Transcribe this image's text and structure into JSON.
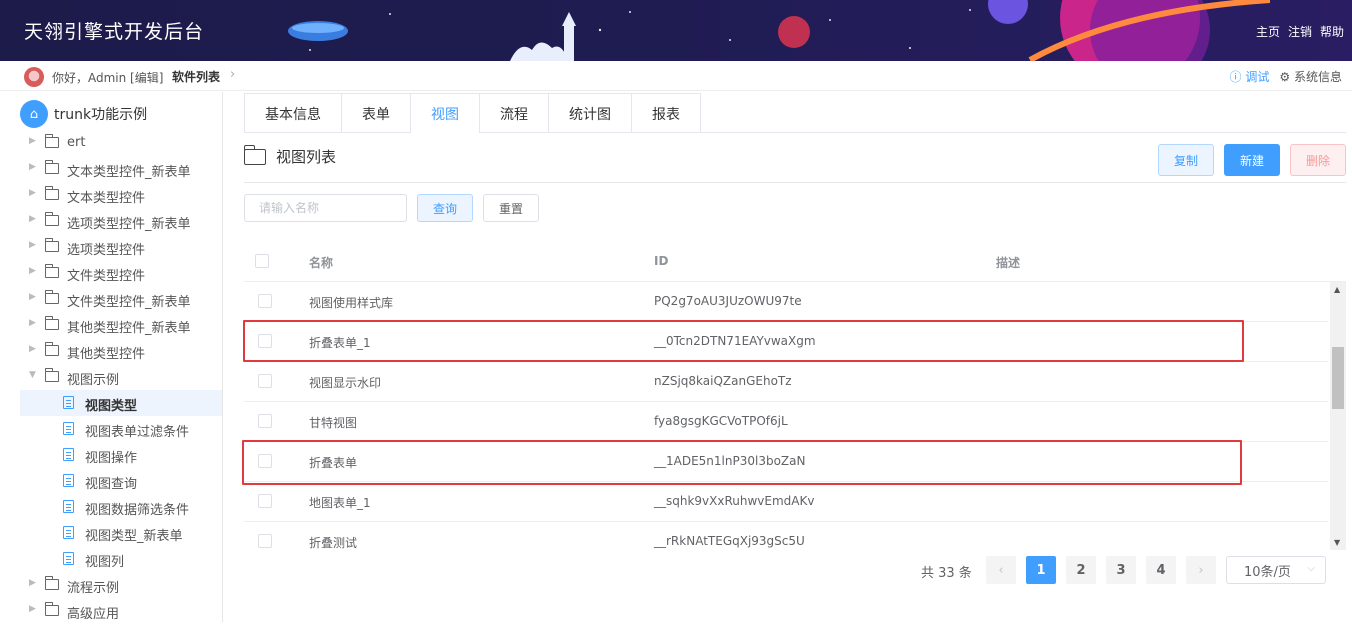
{
  "header": {
    "title": "天翎引擎式开发后台",
    "links": [
      "主页",
      "注销",
      "帮助"
    ]
  },
  "breadcrumb": {
    "greeting": "你好，Admin [编辑]",
    "current": "软件列表",
    "debug": "调试",
    "system_info": "系统信息"
  },
  "sidebar": {
    "root": "trunk功能示例",
    "items": [
      {
        "label": "ert",
        "type": "folder",
        "expanded": false
      },
      {
        "label": "文本类型控件_新表单",
        "type": "folder",
        "expanded": false
      },
      {
        "label": "文本类型控件",
        "type": "folder",
        "expanded": false
      },
      {
        "label": "选项类型控件_新表单",
        "type": "folder",
        "expanded": false
      },
      {
        "label": "选项类型控件",
        "type": "folder",
        "expanded": false
      },
      {
        "label": "文件类型控件",
        "type": "folder",
        "expanded": false
      },
      {
        "label": "文件类型控件_新表单",
        "type": "folder",
        "expanded": false
      },
      {
        "label": "其他类型控件_新表单",
        "type": "folder",
        "expanded": false
      },
      {
        "label": "其他类型控件",
        "type": "folder",
        "expanded": false
      },
      {
        "label": "视图示例",
        "type": "folder",
        "expanded": true
      },
      {
        "label": "视图类型",
        "type": "doc",
        "active": true
      },
      {
        "label": "视图表单过滤条件",
        "type": "doc"
      },
      {
        "label": "视图操作",
        "type": "doc"
      },
      {
        "label": "视图查询",
        "type": "doc"
      },
      {
        "label": "视图数据筛选条件",
        "type": "doc"
      },
      {
        "label": "视图类型_新表单",
        "type": "doc"
      },
      {
        "label": "视图列",
        "type": "doc"
      },
      {
        "label": "流程示例",
        "type": "folder",
        "expanded": false
      },
      {
        "label": "高级应用",
        "type": "folder",
        "expanded": false
      }
    ]
  },
  "tabs": [
    {
      "label": "基本信息"
    },
    {
      "label": "表单"
    },
    {
      "label": "视图",
      "active": true
    },
    {
      "label": "流程"
    },
    {
      "label": "统计图"
    },
    {
      "label": "报表"
    }
  ],
  "section": {
    "title": "视图列表",
    "copy": "复制",
    "new": "新建",
    "delete": "删除"
  },
  "search": {
    "placeholder": "请输入名称",
    "query": "查询",
    "reset": "重置"
  },
  "table": {
    "headers": {
      "name": "名称",
      "id": "ID",
      "desc": "描述"
    },
    "rows": [
      {
        "name": "视图使用样式库",
        "id": "PQ2g7oAU3JUzOWU97te",
        "desc": ""
      },
      {
        "name": "折叠表单_1",
        "id": "__0Tcn2DTN71EAYvwaXgm",
        "desc": "",
        "highlighted": true
      },
      {
        "name": "视图显示水印",
        "id": "nZSjq8kaiQZanGEhoTz",
        "desc": ""
      },
      {
        "name": "甘特视图",
        "id": "fya8gsgKGCVoTPOf6jL",
        "desc": ""
      },
      {
        "name": "折叠表单",
        "id": "__1ADE5n1lnP30l3boZaN",
        "desc": "",
        "highlighted": true
      },
      {
        "name": "地图表单_1",
        "id": "__sqhk9vXxRuhwvEmdAKv",
        "desc": ""
      },
      {
        "name": "折叠测试",
        "id": "__rRkNAtTEGqXj93gSc5U",
        "desc": ""
      }
    ]
  },
  "pagination": {
    "total": "共 33 条",
    "pages": [
      "1",
      "2",
      "3",
      "4"
    ],
    "current": "1",
    "page_size": "10条/页"
  },
  "colors": {
    "primary": "#409eff",
    "header_bg": "#1e1c50",
    "highlight_border": "#e0393e",
    "danger": "#f89898"
  }
}
